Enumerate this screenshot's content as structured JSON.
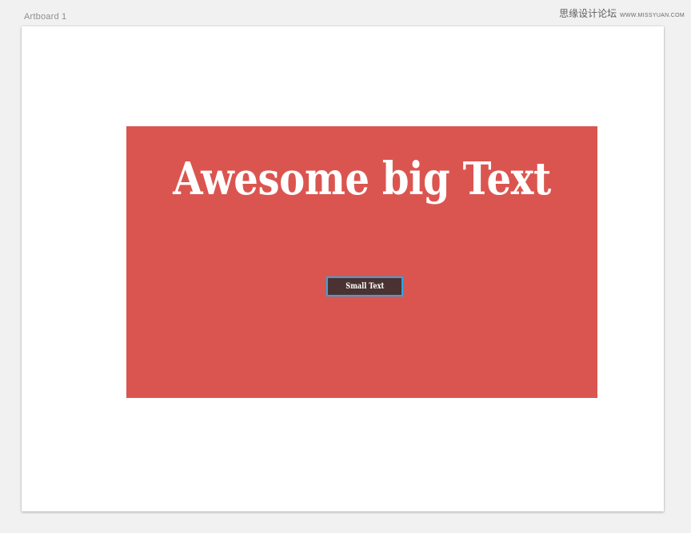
{
  "canvas": {
    "artboard_label": "Artboard 1",
    "background_color": "#f1f1f1"
  },
  "watermark": {
    "prefix": "思缘设计论坛",
    "suffix": "WWW.MISSYUAN.COM"
  },
  "banner": {
    "color": "#db5550",
    "heading": "Awesome big Text",
    "small_box": {
      "label": "Small Text",
      "fill_color": "#4a3232",
      "selection_color": "#2aa7e6",
      "selected": true
    }
  }
}
